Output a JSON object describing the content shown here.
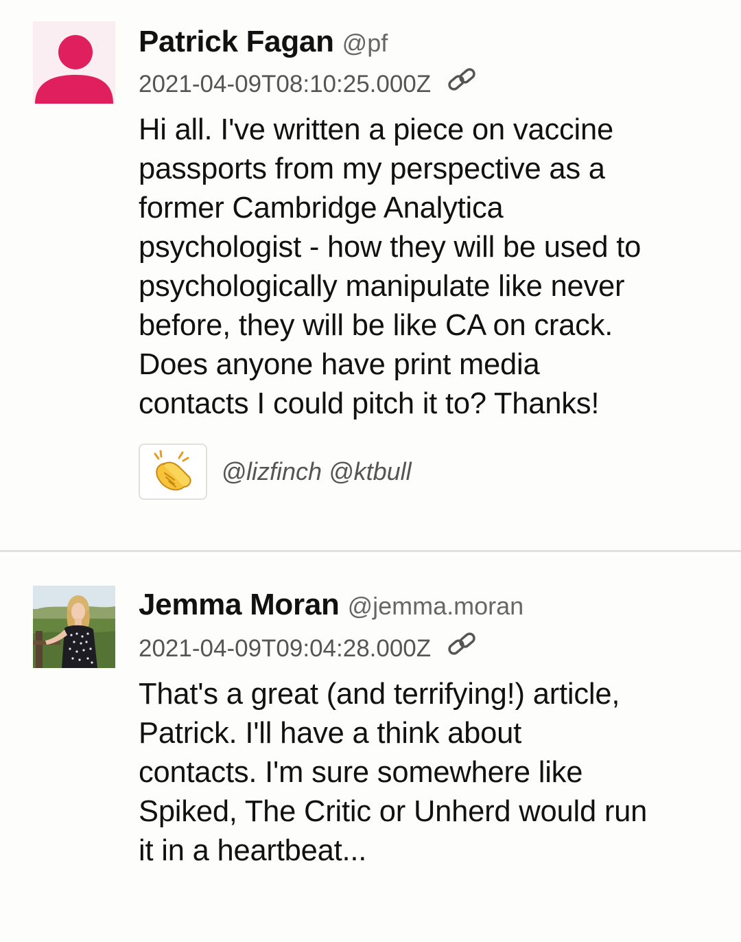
{
  "posts": [
    {
      "author_name": "Patrick Fagan",
      "author_handle": "@pf",
      "timestamp": "2021-04-09T08:10:25.000Z",
      "body": "Hi all. I've written a piece on vaccine\npassports from my perspective as a\nformer Cambridge Analytica\npsychologist - how they will be used to\npsychologically manipulate like never\nbefore, they will be like CA on crack.\nDoes anyone have print media\ncontacts I could pitch it to? Thanks!",
      "avatar": "default-user-avatar",
      "reaction": {
        "icon": "clapping-hands-icon",
        "users": "@lizfinch @ktbull"
      }
    },
    {
      "author_name": "Jemma Moran",
      "author_handle": "@jemma.moran",
      "timestamp": "2021-04-09T09:04:28.000Z",
      "body": "That's a great (and terrifying!) article,\nPatrick. I'll have a think about\ncontacts. I'm sure somewhere like\nSpiked, The Critic or Unherd would run\nit in a heartbeat...",
      "avatar": "user-photo-avatar"
    }
  ],
  "colors": {
    "background": "#fdfdfb",
    "avatar_default_fg": "#e0205e",
    "avatar_default_bg": "#fbeef3",
    "divider": "#e2e0dd",
    "muted_text": "#666666"
  }
}
